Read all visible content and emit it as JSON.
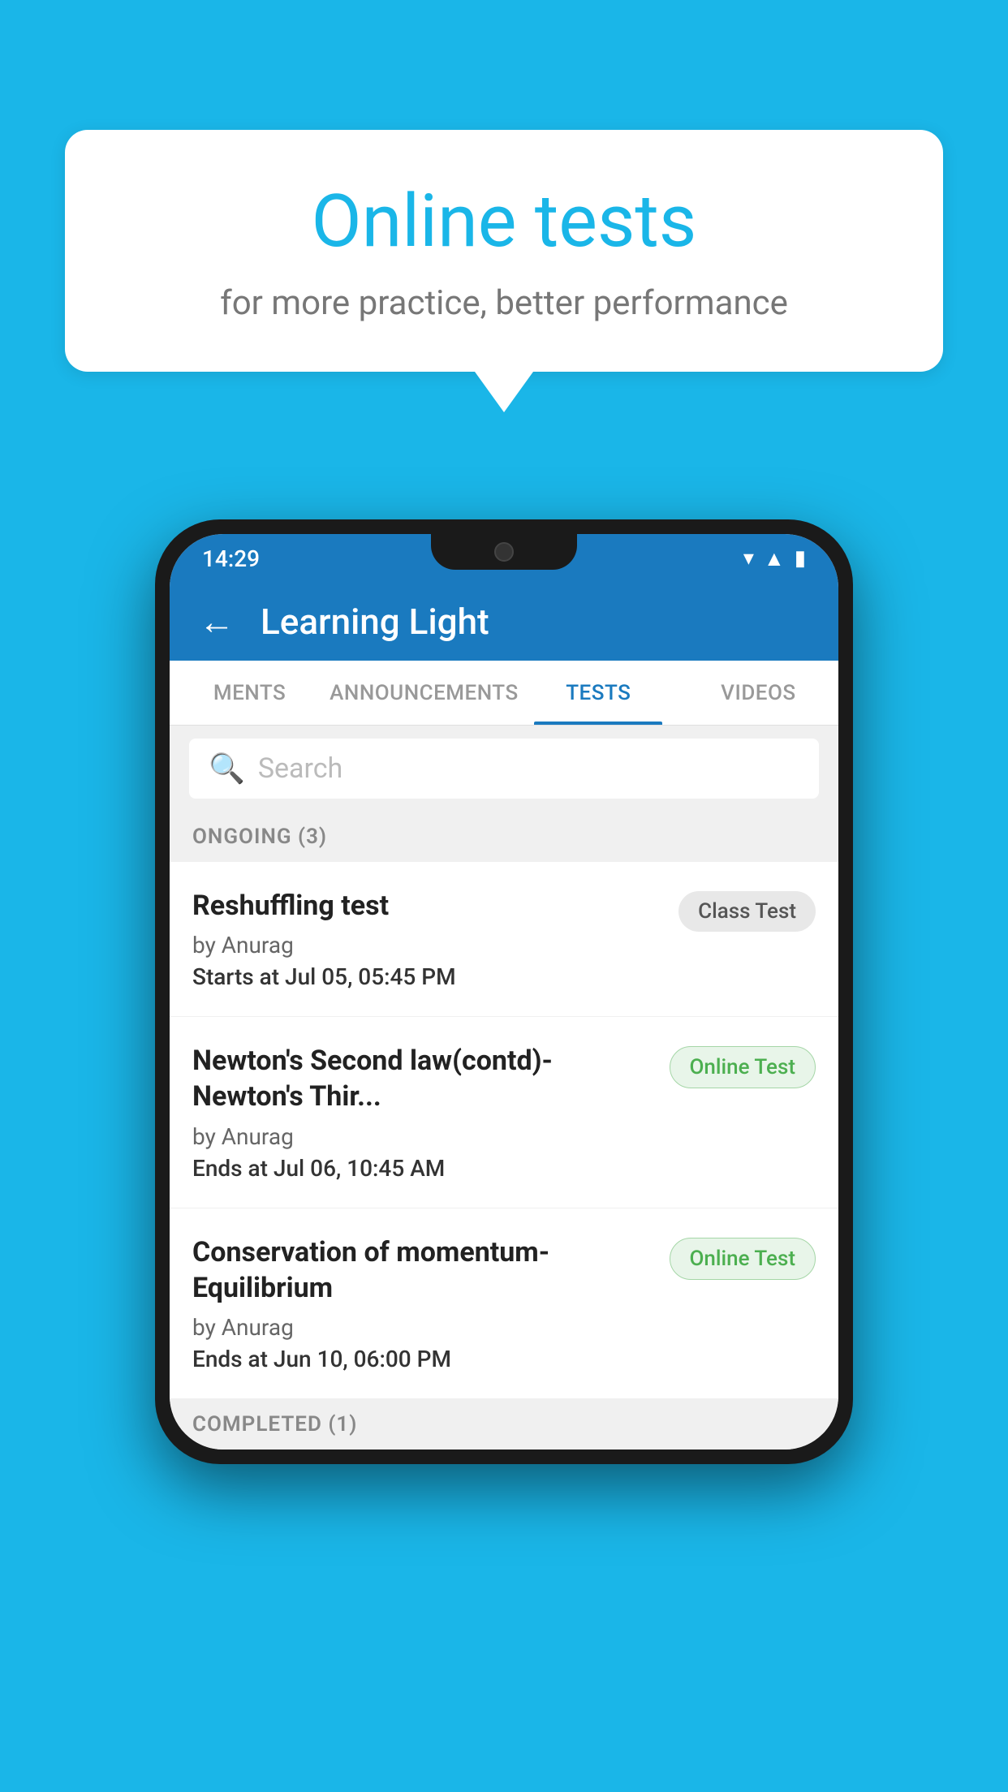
{
  "background": {
    "color": "#1ab6e8"
  },
  "speech_bubble": {
    "title": "Online tests",
    "subtitle": "for more practice, better performance"
  },
  "phone": {
    "status_bar": {
      "time": "14:29",
      "icons": [
        "wifi",
        "signal",
        "battery"
      ]
    },
    "header": {
      "title": "Learning Light",
      "back_label": "←"
    },
    "tabs": [
      {
        "label": "MENTS",
        "active": false
      },
      {
        "label": "ANNOUNCEMENTS",
        "active": false
      },
      {
        "label": "TESTS",
        "active": true
      },
      {
        "label": "VIDEOS",
        "active": false
      }
    ],
    "search": {
      "placeholder": "Search"
    },
    "ongoing_section": {
      "title": "ONGOING (3)",
      "tests": [
        {
          "name": "Reshuffling test",
          "by": "by Anurag",
          "date_label": "Starts at",
          "date_value": "Jul 05, 05:45 PM",
          "badge": "Class Test",
          "badge_type": "class"
        },
        {
          "name": "Newton's Second law(contd)-Newton's Thir...",
          "by": "by Anurag",
          "date_label": "Ends at",
          "date_value": "Jul 06, 10:45 AM",
          "badge": "Online Test",
          "badge_type": "online"
        },
        {
          "name": "Conservation of momentum-Equilibrium",
          "by": "by Anurag",
          "date_label": "Ends at",
          "date_value": "Jun 10, 06:00 PM",
          "badge": "Online Test",
          "badge_type": "online"
        }
      ]
    },
    "completed_section": {
      "title": "COMPLETED (1)"
    }
  }
}
